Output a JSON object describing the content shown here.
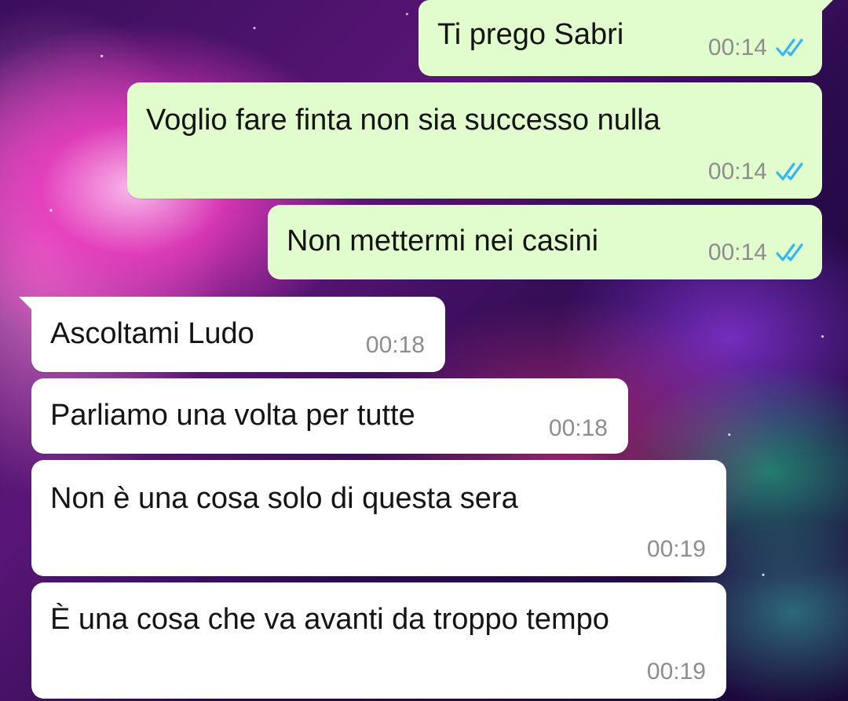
{
  "messages": [
    {
      "text": "Ti prego Sabri",
      "time": "00:14",
      "ticks": "double-check-read-icon",
      "direction": "outgoing"
    },
    {
      "text": "Voglio fare finta non sia successo nulla",
      "time": "00:14",
      "ticks": "double-check-read-icon",
      "direction": "outgoing"
    },
    {
      "text": "Non mettermi nei casini",
      "time": "00:14",
      "ticks": "double-check-read-icon",
      "direction": "outgoing"
    },
    {
      "text": "Ascoltami Ludo",
      "time": "00:18",
      "direction": "incoming"
    },
    {
      "text": "Parliamo una volta per tutte",
      "time": "00:18",
      "direction": "incoming"
    },
    {
      "text": "Non è una cosa solo di questa sera",
      "time": "00:19",
      "direction": "incoming"
    },
    {
      "text": "È una cosa che va avanti da troppo tempo",
      "time": "00:19",
      "direction": "incoming"
    }
  ],
  "colors": {
    "outgoing_bubble": "#e2fdcd",
    "incoming_bubble": "#ffffff",
    "read_ticks": "#34b7f1",
    "timestamp": "#8d8d8d"
  }
}
